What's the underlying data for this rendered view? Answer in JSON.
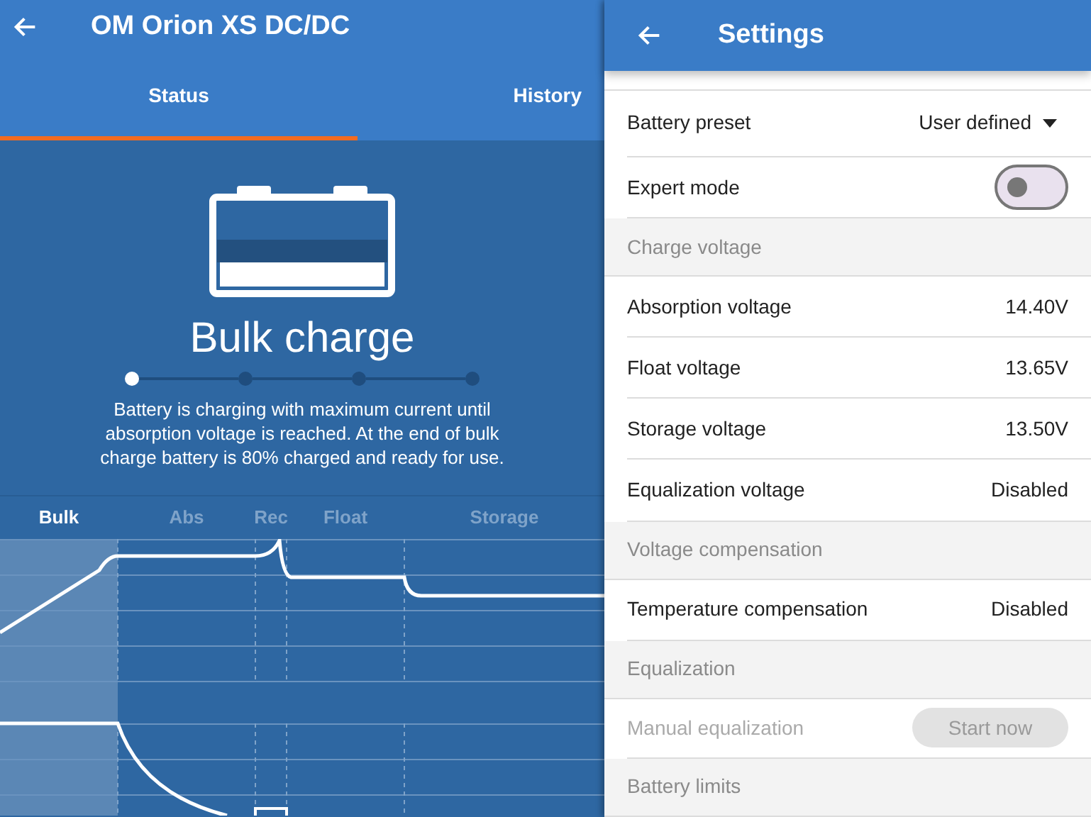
{
  "status_panel": {
    "title": "OM Orion XS DC/DC",
    "tabs": [
      {
        "label": "Status",
        "selected": true
      },
      {
        "label": "History",
        "selected": false
      }
    ],
    "state_title": "Bulk charge",
    "steps": [
      {
        "selected": true
      },
      {
        "selected": false
      },
      {
        "selected": false
      },
      {
        "selected": false
      }
    ],
    "description": "Battery is charging with maximum current until absorption voltage is reached. At the end of bulk charge battery is 80% charged and ready for use.",
    "phases": [
      {
        "label": "Bulk",
        "selected": true
      },
      {
        "label": "Abs",
        "selected": false
      },
      {
        "label": "Rec",
        "selected": false
      },
      {
        "label": "Float",
        "selected": false
      },
      {
        "label": "Storage",
        "selected": false
      }
    ]
  },
  "settings_panel": {
    "title": "Settings",
    "rows": [
      {
        "kind": "select",
        "label": "Battery preset",
        "value": "User defined"
      },
      {
        "kind": "toggle",
        "label": "Expert mode",
        "on": false
      },
      {
        "kind": "section",
        "label": "Charge voltage"
      },
      {
        "kind": "value",
        "label": "Absorption voltage",
        "value": "14.40V"
      },
      {
        "kind": "value",
        "label": "Float voltage",
        "value": "13.65V"
      },
      {
        "kind": "value",
        "label": "Storage voltage",
        "value": "13.50V"
      },
      {
        "kind": "value",
        "label": "Equalization voltage",
        "value": "Disabled"
      },
      {
        "kind": "section",
        "label": "Voltage compensation"
      },
      {
        "kind": "value",
        "label": "Temperature compensation",
        "value": "Disabled"
      },
      {
        "kind": "section",
        "label": "Equalization"
      },
      {
        "kind": "button",
        "label": "Manual equalization",
        "button": "Start now",
        "disabled": true
      },
      {
        "kind": "section",
        "label": "Battery limits"
      }
    ]
  }
}
